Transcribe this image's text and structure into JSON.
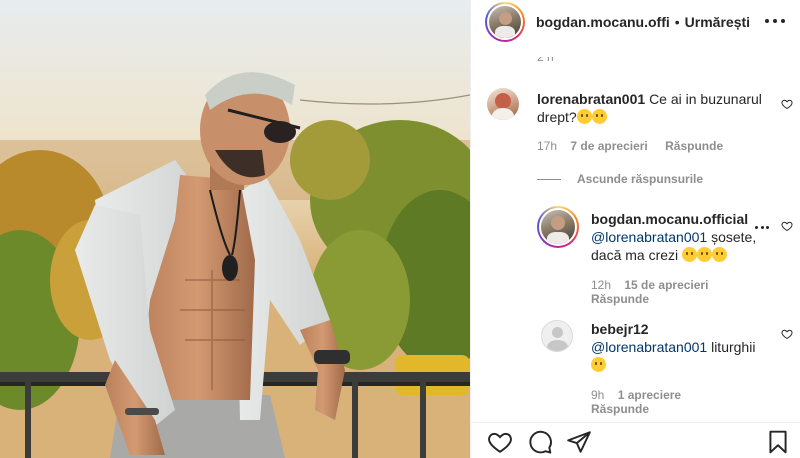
{
  "post": {
    "author_username": "bogdan.mocanu.offi",
    "separator": "•",
    "follow_label": "Urmărești"
  },
  "comments": {
    "partial_time": "2 h",
    "items": [
      {
        "username": "lorenabratan001",
        "text": "Ce ai in buzunarul drept?",
        "emoji": "🤭🤭",
        "time": "17h",
        "likes": "7 de aprecieri",
        "reply_label": "Răspunde"
      }
    ],
    "hide_replies_label": "Ascunde răspunsurile",
    "replies": [
      {
        "username": "bogdan.mocanu.official",
        "mention": "@lorenabratan001",
        "text": " șosete, dacă ma crezi ",
        "emoji": "😂😂😂",
        "time": "12h",
        "likes": "15 de aprecieri",
        "reply_label": "Răspunde"
      },
      {
        "username": "bebejr12",
        "mention": "@lorenabratan001",
        "text": " liturghii ",
        "emoji": "🤣",
        "time": "9h",
        "likes": "1 apreciere",
        "reply_label": "Răspunde"
      }
    ]
  },
  "colors": {
    "text": "#262626",
    "muted": "#8e8e8e",
    "mention": "#00376b",
    "border": "#efefef"
  },
  "icons": [
    "like-heart-icon",
    "comment-bubble-icon",
    "share-plane-icon",
    "save-bookmark-icon",
    "more-dots-icon"
  ]
}
